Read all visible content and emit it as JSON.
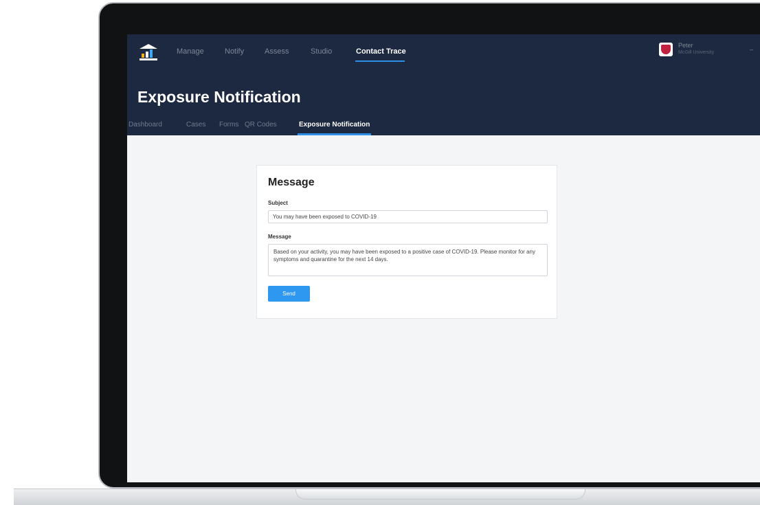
{
  "app": {
    "brand_colors": {
      "topbar": "#1d2940",
      "accent": "#2e8fe6",
      "button": "#2e97f0"
    },
    "logo_icon": "building-chart-icon"
  },
  "nav": {
    "items": [
      {
        "label": "Manage"
      },
      {
        "label": "Notify"
      },
      {
        "label": "Assess"
      },
      {
        "label": "Studio"
      },
      {
        "label": "Contact Trace",
        "active": true
      }
    ]
  },
  "user": {
    "name": "Peter",
    "org": "McGill University",
    "avatar_icon": "university-crest-icon",
    "menu_icon": "menu-caret-icon"
  },
  "page": {
    "title": "Exposure Notification",
    "subnav": [
      {
        "label": "Dashboard"
      },
      {
        "label": "Cases"
      },
      {
        "label": "Forms"
      },
      {
        "label": "QR Codes"
      },
      {
        "label": "Exposure Notification",
        "active": true
      }
    ]
  },
  "form": {
    "heading": "Message",
    "subject_label": "Subject",
    "subject_value": "You may have been exposed to COVID-19",
    "message_label": "Message",
    "message_value": "Based on your activity, you may have been exposed to a positive case of COVID-19. Please monitor for any symptoms and quarantine for the next 14 days.",
    "send_label": "Send"
  }
}
